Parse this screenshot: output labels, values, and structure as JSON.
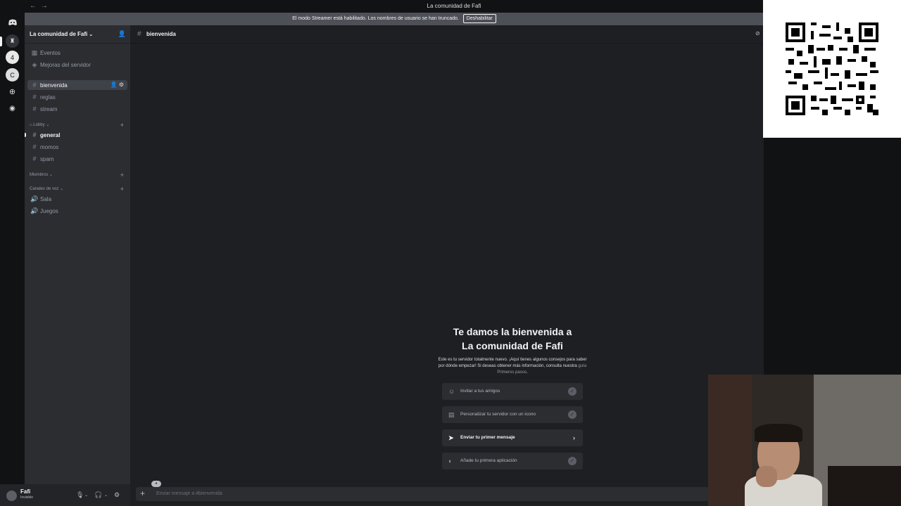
{
  "window": {
    "title": "La comunidad de Fafi",
    "back": "←",
    "forward": "→"
  },
  "streamer_bar": {
    "text": "El modo Streamer está habilitado. Los nombres de usuario se han truncado.",
    "button": "Deshabilitar"
  },
  "server": {
    "name": "La comunidad de Fafi",
    "chevron": "⌄"
  },
  "sidebar": {
    "top_items": [
      {
        "label": "Eventos",
        "icon": "calendar-icon"
      },
      {
        "label": "Mejoras del servidor",
        "icon": "boost-icon"
      }
    ],
    "channels": [
      {
        "label": "bienvenida",
        "state": "active"
      },
      {
        "label": "reglas",
        "state": "normal"
      },
      {
        "label": "stream",
        "state": "normal"
      }
    ],
    "lobby_category": "Lobby",
    "lobby_channels": [
      {
        "label": "general",
        "state": "unread"
      },
      {
        "label": "momos",
        "state": "normal"
      },
      {
        "label": "spam",
        "state": "normal"
      }
    ],
    "members_category": "Miembros",
    "voice_category": "Canales de voz",
    "voice_channels": [
      {
        "label": "Sala"
      },
      {
        "label": "Juegos"
      }
    ]
  },
  "user": {
    "name": "Fafi",
    "status": "Invisible"
  },
  "main": {
    "channel": "bienvenida",
    "welcome_title_line1": "Te damos la bienvenida a",
    "welcome_title_line2": "La comunidad de Fafi",
    "welcome_desc": "Este es tu servidor totalmente nuevo. ¡Aquí tienes algunos consejos para saber por dónde empezar! Si deseas obtener más información, consulta nuestra",
    "welcome_link": "guía Primeros pasos",
    "welcome_end": ".",
    "tasks": [
      {
        "label": "Invitar a tus amigos",
        "done": true,
        "icon": "invite-icon"
      },
      {
        "label": "Personalizar tu servidor con un icono",
        "done": true,
        "icon": "customize-icon"
      },
      {
        "label": "Enviar tu primer mensaje",
        "done": false,
        "icon": "send-icon"
      },
      {
        "label": "Añade tu primera aplicación",
        "done": true,
        "icon": "app-icon"
      }
    ],
    "composer_placeholder": "Enviar mensaje a #bienvenida"
  },
  "colors": {
    "accent": "#5865f2",
    "sidebar": "#2b2d31",
    "chat": "#1e1f22"
  }
}
